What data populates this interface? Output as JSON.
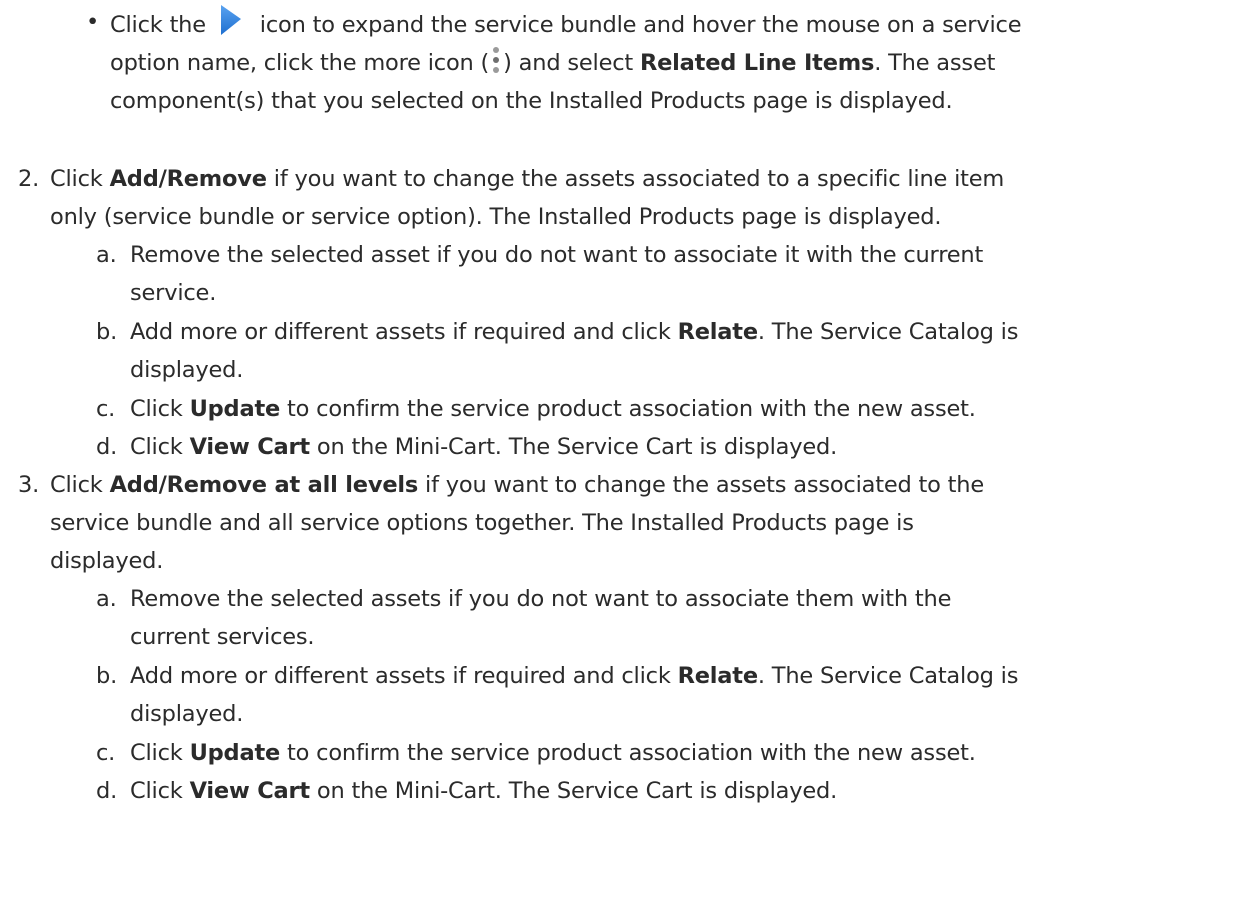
{
  "bullet": {
    "marker": "•",
    "l1_a": "Click the",
    "arrow_icon": "expand-arrow-icon",
    "l1_b": "icon to expand the service bundle and hover the mouse on a service",
    "l2_a": "option name, click the more icon (",
    "more_icon": "more-vertical-icon",
    "l2_b": ") and select",
    "l2_bold": "Related Line Items",
    "l2_c": ". The asset",
    "l3": "component(s) that you selected on the Installed Products page is displayed."
  },
  "step2": {
    "marker": "2.",
    "l1_a": "Click",
    "l1_bold": "Add/Remove",
    "l1_b": "if you want to change the assets associated to a specific line item",
    "l2": "only (service bundle or service option). The Installed Products page is displayed.",
    "a": {
      "marker": "a.",
      "l1": "Remove the selected asset if you do not want to associate it with the current",
      "l2": "service."
    },
    "b": {
      "marker": "b.",
      "l1_a": "Add more or different assets if required and click",
      "l1_bold": "Relate",
      "l1_b": ". The Service Catalog is",
      "l2": "displayed."
    },
    "c": {
      "marker": "c.",
      "l1_a": "Click",
      "l1_bold": "Update",
      "l1_b": "to confirm the service product association with the new asset."
    },
    "d": {
      "marker": "d.",
      "l1_a": "Click",
      "l1_bold": "View Cart",
      "l1_b": "on the Mini-Cart. The Service Cart is displayed."
    }
  },
  "step3": {
    "marker": "3.",
    "l1_a": "Click",
    "l1_bold": "Add/Remove at all levels",
    "l1_b": "if you want to change the assets associated to the",
    "l2": "service bundle and all service options together. The Installed Products page is",
    "l3": "displayed.",
    "a": {
      "marker": "a.",
      "l1": "Remove the selected assets if you do not want to associate them with the",
      "l2": "current services."
    },
    "b": {
      "marker": "b.",
      "l1_a": "Add more or different assets if required and click",
      "l1_bold": "Relate",
      "l1_b": ". The Service Catalog is",
      "l2": "displayed."
    },
    "c": {
      "marker": "c.",
      "l1_a": "Click",
      "l1_bold": "Update",
      "l1_b": "to confirm the service product association with the new asset."
    },
    "d": {
      "marker": "d.",
      "l1_a": "Click",
      "l1_bold": "View Cart",
      "l1_b": "on the Mini-Cart. The Service Cart is displayed."
    }
  }
}
